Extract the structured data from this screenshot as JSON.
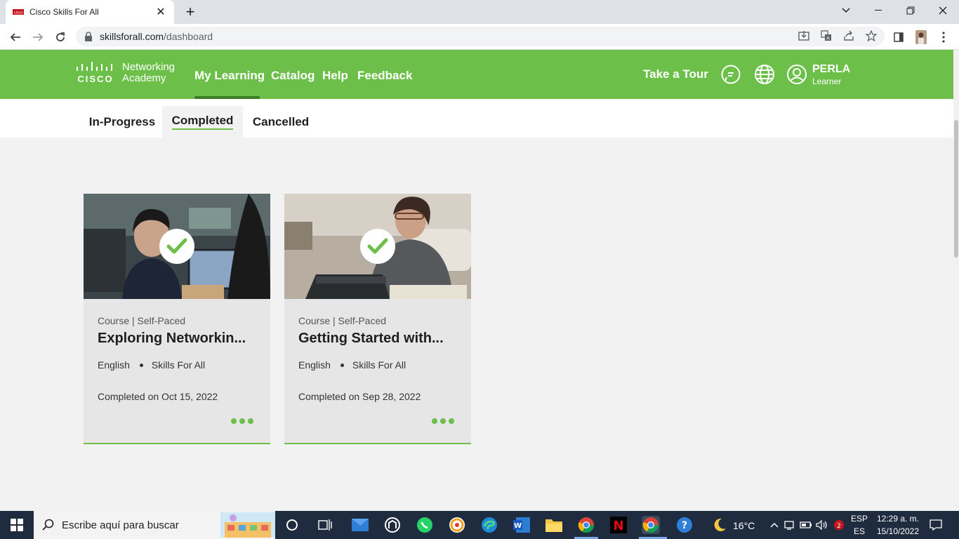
{
  "browser": {
    "tab_title": "Cisco Skills For All",
    "url_host": "skillsforall.com",
    "url_path": "/dashboard"
  },
  "header": {
    "logo_line1": "Networking",
    "logo_line2": "Academy",
    "logo_word": "CISCO",
    "nav": [
      "My Learning",
      "Catalog",
      "Help",
      "Feedback"
    ],
    "take_tour": "Take a Tour",
    "user_name": "PERLA",
    "user_role": "Learner",
    "brand_color": "#6cc04a"
  },
  "subtabs": [
    "In-Progress",
    "Completed",
    "Cancelled"
  ],
  "cards": [
    {
      "type": "Course | Self-Paced",
      "title": "Exploring Networkin...",
      "language": "English",
      "program": "Skills For All",
      "completed": "Completed on Oct 15, 2022"
    },
    {
      "type": "Course | Self-Paced",
      "title": "Getting Started with...",
      "language": "English",
      "program": "Skills For All",
      "completed": "Completed on Sep 28, 2022"
    }
  ],
  "taskbar": {
    "search_placeholder": "Escribe aquí para buscar",
    "weather": "16°C",
    "lang_top": "ESP",
    "lang_bottom": "ES",
    "time": "12:29 a. m.",
    "date": "15/10/2022"
  }
}
